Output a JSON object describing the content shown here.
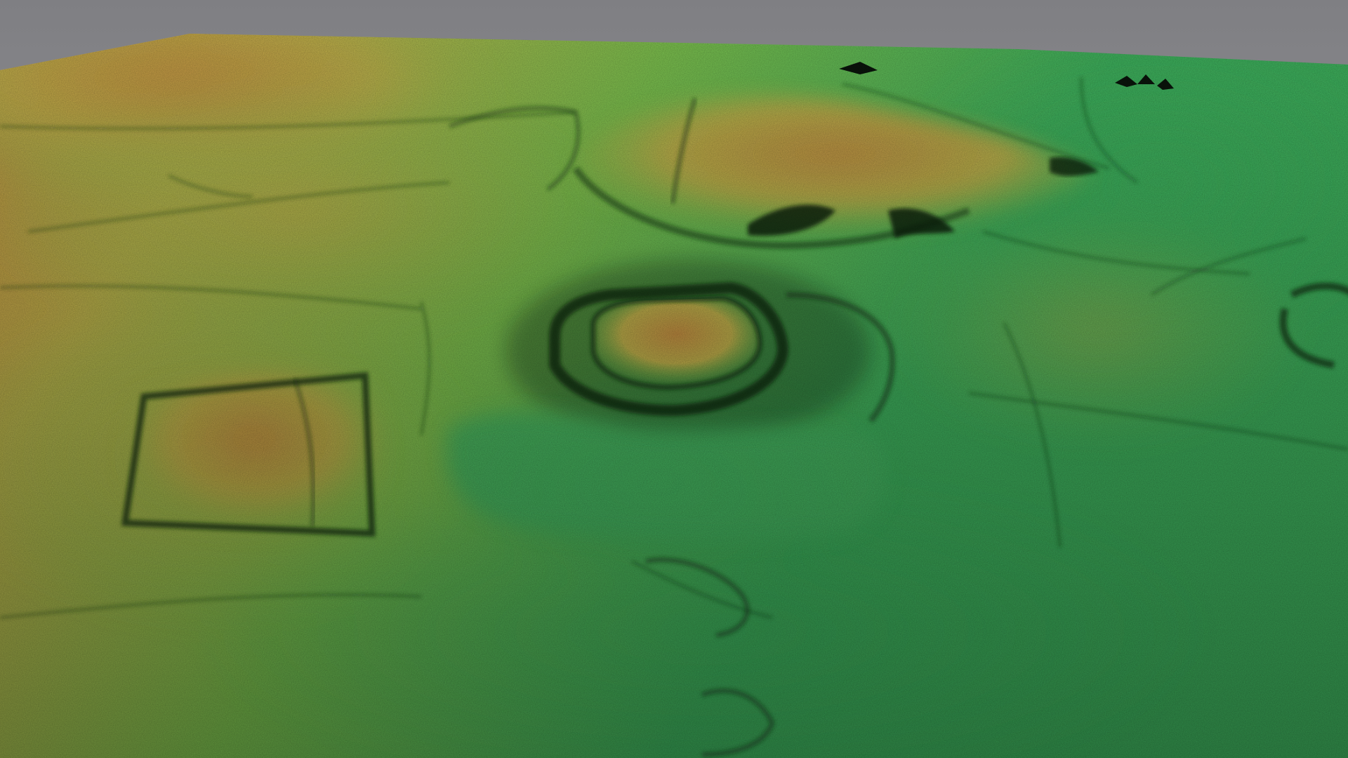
{
  "scene": {
    "type": "lidar-elevation-terrain-render",
    "colors": {
      "sky_top": "#7f7f83",
      "sky_bottom": "#a7a7aa",
      "low_ground": "#3fb35e",
      "mid_ground": "#7dc24f",
      "high_ground": "#c2b24c",
      "peak_ground": "#c89243",
      "shadow": "#0f2a14",
      "void": "#000000"
    }
  }
}
